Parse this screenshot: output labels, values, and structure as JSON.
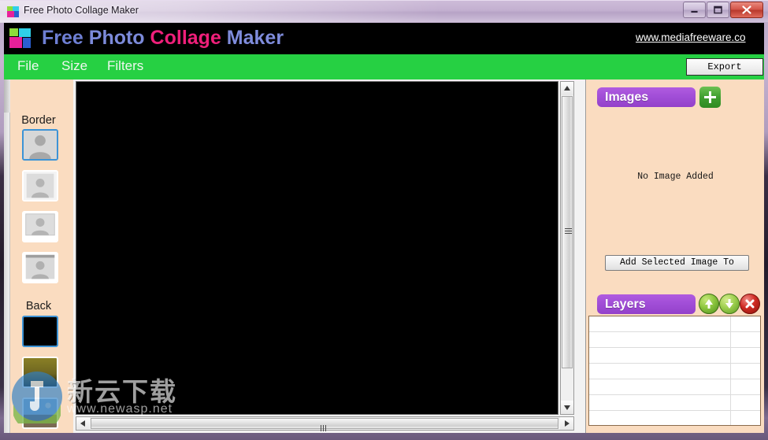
{
  "window": {
    "title": "Free Photo Collage Maker",
    "title_icon": "app-collage-icon",
    "ghost_reflection_1": "",
    "ghost_reflection_2": "",
    "ghost_reflection_3": "",
    "controls": {
      "minimize": "minimize-icon",
      "maximize": "maximize-icon",
      "close": "close-icon"
    },
    "frame_color": "#b7a3c6"
  },
  "brand": {
    "logo": "collage-logo-icon",
    "word1": "Free",
    "word2": "Photo",
    "word3": "Collage",
    "word4": "Maker",
    "url": "www.mediafreeware.co",
    "color_blue": "#6e7fd4",
    "color_pink": "#ef1f7a"
  },
  "menubar": {
    "background": "#26d043",
    "items": [
      {
        "label": "File"
      },
      {
        "label": "Size"
      },
      {
        "label": "Filters"
      }
    ],
    "export_label": "Export"
  },
  "sidebar": {
    "background": "#fadcc0",
    "sections": [
      {
        "label": "Border",
        "swatches": [
          {
            "name": "border-swatch-1",
            "selected": true
          },
          {
            "name": "border-swatch-2",
            "selected": false
          },
          {
            "name": "border-swatch-3",
            "selected": false
          },
          {
            "name": "border-swatch-4",
            "selected": false
          }
        ]
      },
      {
        "label": "Back",
        "swatches": [
          {
            "name": "back-swatch-black",
            "selected": true,
            "color": "#000000"
          },
          {
            "name": "back-swatch-olive",
            "selected": false,
            "color": "#7d7424"
          },
          {
            "name": "back-swatch-photo",
            "selected": false,
            "color": "#8fa6b8"
          }
        ]
      }
    ]
  },
  "canvas": {
    "background": "#000000",
    "vertical_scrollbar": {
      "up_arrow": "scroll-up-icon",
      "down_arrow": "scroll-down-icon",
      "grip": "scroll-grip-icon"
    },
    "horizontal_scrollbar": {
      "left_arrow": "scroll-left-icon",
      "right_arrow": "scroll-right-icon",
      "grip": "scroll-grip-icon"
    }
  },
  "right_panel": {
    "background": "#fadcc0",
    "images": {
      "title": "Images",
      "add_button": "plus-icon",
      "empty_text": "No Image Added",
      "add_selected_label": "Add Selected Image To"
    },
    "layers": {
      "title": "Layers",
      "move_up": "arrow-up-icon",
      "move_down": "arrow-down-icon",
      "delete": "delete-x-icon",
      "rows": [
        {
          "name": ""
        },
        {
          "name": ""
        },
        {
          "name": ""
        },
        {
          "name": ""
        },
        {
          "name": ""
        },
        {
          "name": ""
        },
        {
          "name": ""
        }
      ]
    },
    "accent_purple": "#a04dd6"
  },
  "watermark": {
    "logo": "newasp-logo-icon",
    "text_cn": "新云下载",
    "url": "www.newasp.net"
  }
}
